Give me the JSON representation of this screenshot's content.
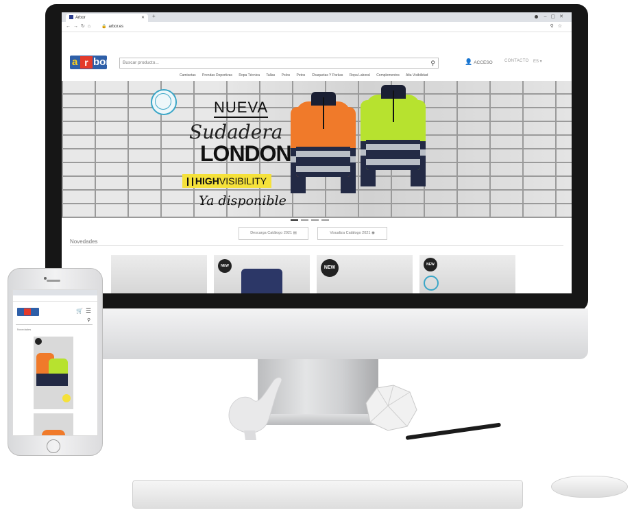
{
  "browser": {
    "tab_title": "Arbor",
    "url": "arbor.es"
  },
  "site": {
    "logo_text_a": "a",
    "logo_text_r": "r",
    "logo_text_bor": "bor",
    "search_placeholder": "Buscar producto...",
    "acceso": "ACCESO",
    "contacto": "CONTACTO",
    "lang": "ES",
    "menu": [
      "Camisetas",
      "Prendas Deportivas",
      "Ropa Técnica",
      "Tallas",
      "Polos",
      "Petos",
      "Chaquetas Y Parkas",
      "Ropa Laboral",
      "Complementos",
      "Alta Visibilidad"
    ]
  },
  "hero": {
    "line1": "NUEVA",
    "line2": "Sudadera",
    "line3": "LONDON",
    "hiviz_strong": "HIGH",
    "hiviz_rest": "VISIBILITY",
    "line5": "Ya disponible",
    "slides": 4,
    "active_slide": 1
  },
  "catalog": {
    "download": "Descarga Catálogo 2021",
    "view": "Visualiza Catálogo 2021"
  },
  "novedades": {
    "title": "Novedades",
    "new_badge": "NEW"
  },
  "phone": {
    "novedades": "Novedades"
  },
  "colors": {
    "orange": "#f07a2a",
    "lime": "#b7e22f",
    "navy": "#232a45",
    "logo_blue": "#2e5fa8",
    "logo_red": "#e43a2a",
    "hiviz_yellow": "#f5e13a"
  }
}
